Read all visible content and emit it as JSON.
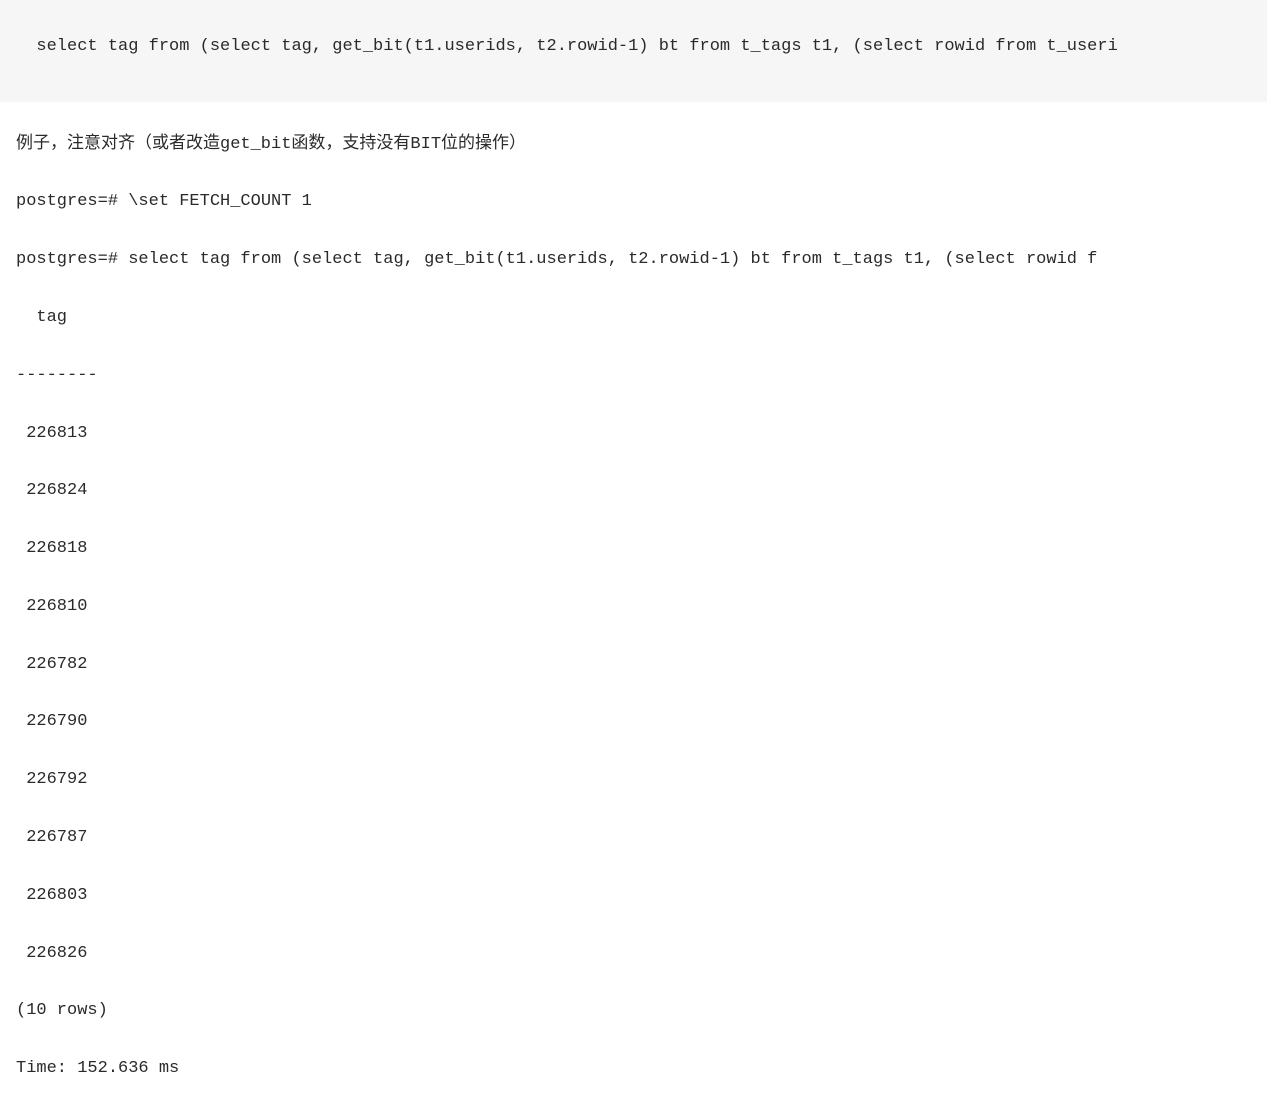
{
  "top_query": "select tag from (select tag, get_bit(t1.userids, t2.rowid-1) bt from t_tags t1, (select rowid from t_useri",
  "comment": "例子，注意对齐（或者改造get_bit函数，支持没有BIT位的操作）",
  "line1": "postgres=# \\set FETCH_COUNT 1",
  "line2": "postgres=# select tag from (select tag, get_bit(t1.userids, t2.rowid-1) bt from t_tags t1, (select rowid f",
  "header": "  tag   ",
  "divider": "--------",
  "rows": [
    " 226813",
    " 226824",
    " 226818",
    " 226810",
    " 226782",
    " 226790",
    " 226792",
    " 226787",
    " 226803",
    " 226826"
  ],
  "row_count": "(10 rows)",
  "time": "Time: 152.636 ms"
}
